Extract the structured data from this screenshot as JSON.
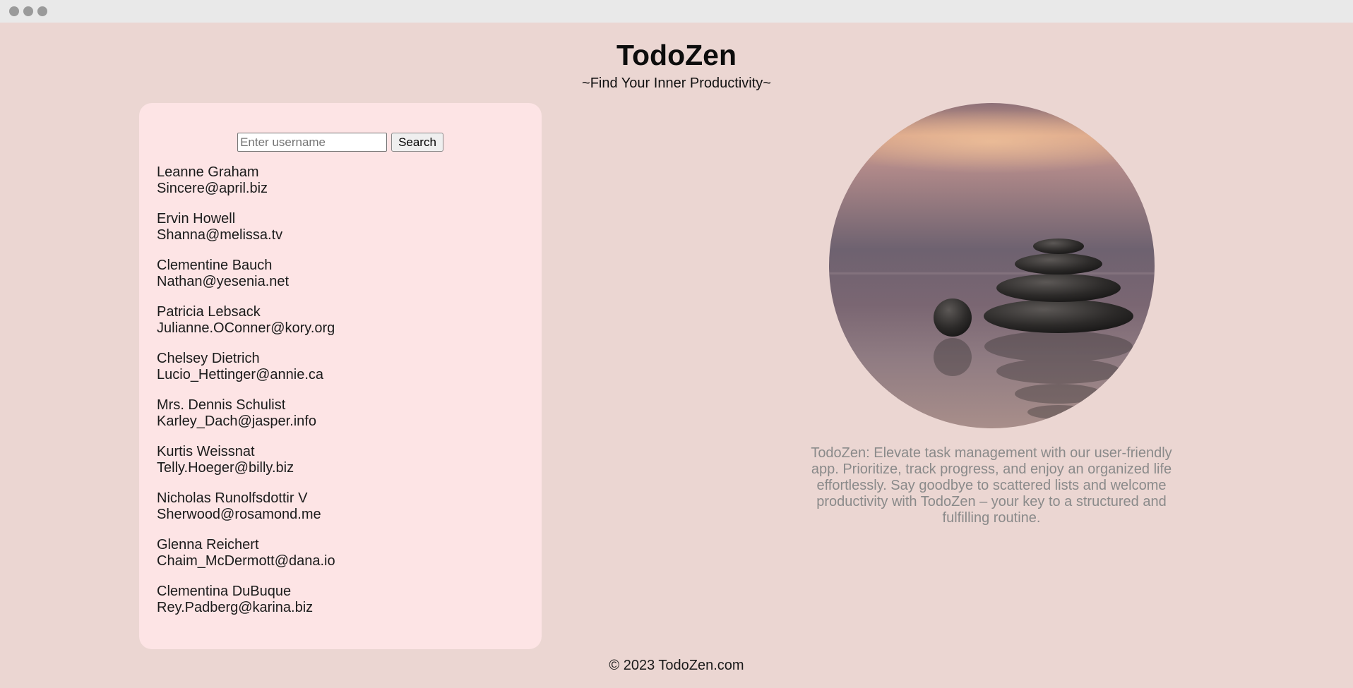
{
  "app": {
    "title": "TodoZen",
    "subtitle": "~Find Your Inner Productivity~"
  },
  "search": {
    "placeholder": "Enter username",
    "value": "",
    "button_label": "Search"
  },
  "users": [
    {
      "name": "Leanne Graham",
      "email": "Sincere@april.biz"
    },
    {
      "name": "Ervin Howell",
      "email": "Shanna@melissa.tv"
    },
    {
      "name": "Clementine Bauch",
      "email": "Nathan@yesenia.net"
    },
    {
      "name": "Patricia Lebsack",
      "email": "Julianne.OConner@kory.org"
    },
    {
      "name": "Chelsey Dietrich",
      "email": "Lucio_Hettinger@annie.ca"
    },
    {
      "name": "Mrs. Dennis Schulist",
      "email": "Karley_Dach@jasper.info"
    },
    {
      "name": "Kurtis Weissnat",
      "email": "Telly.Hoeger@billy.biz"
    },
    {
      "name": "Nicholas Runolfsdottir V",
      "email": "Sherwood@rosamond.me"
    },
    {
      "name": "Glenna Reichert",
      "email": "Chaim_McDermott@dana.io"
    },
    {
      "name": "Clementina DuBuque",
      "email": "Rey.Padberg@karina.biz"
    }
  ],
  "description": "TodoZen: Elevate task management with our user-friendly app. Prioritize, track progress, and enjoy an organized life effortlessly. Say goodbye to scattered lists and welcome productivity with TodoZen – your key to a structured and fulfilling routine.",
  "footer": "© 2023 TodoZen.com",
  "colors": {
    "page_background": "#ebd6d2",
    "panel_background": "#fde4e5",
    "description_text": "#8a8a8a"
  }
}
